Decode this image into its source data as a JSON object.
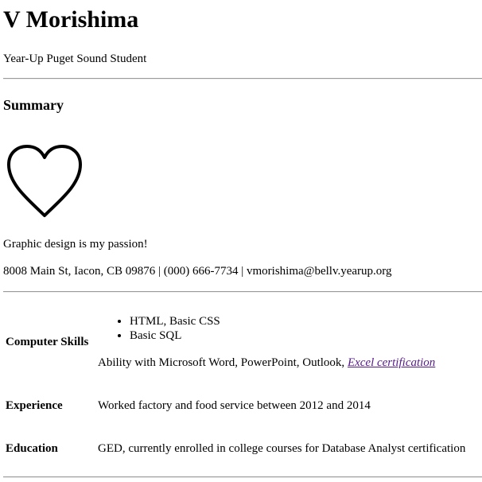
{
  "header": {
    "name": "V Morishima",
    "tagline": "Year-Up Puget Sound Student"
  },
  "summary": {
    "heading": "Summary",
    "icon": "heart-icon",
    "passion": "Graphic design is my passion!",
    "contact": "8008 Main St, Iacon, CB 09876 | (000) 666-7734 | vmorishima@bellv.yearup.org"
  },
  "details": {
    "computer_skills": {
      "label": "Computer Skills",
      "list": [
        "HTML, Basic CSS",
        "Basic SQL"
      ],
      "ability_text": "Ability with Microsoft Word, PowerPoint, Outlook, ",
      "ability_link": "Excel certification"
    },
    "experience": {
      "label": "Experience",
      "value": "Worked factory and food service between 2012 and 2014"
    },
    "education": {
      "label": "Education",
      "value": "GED, currently enrolled in college courses for Database Analyst certification"
    }
  },
  "colors": {
    "link_visited": "#551a8b",
    "rule": "#9a9a9a"
  }
}
